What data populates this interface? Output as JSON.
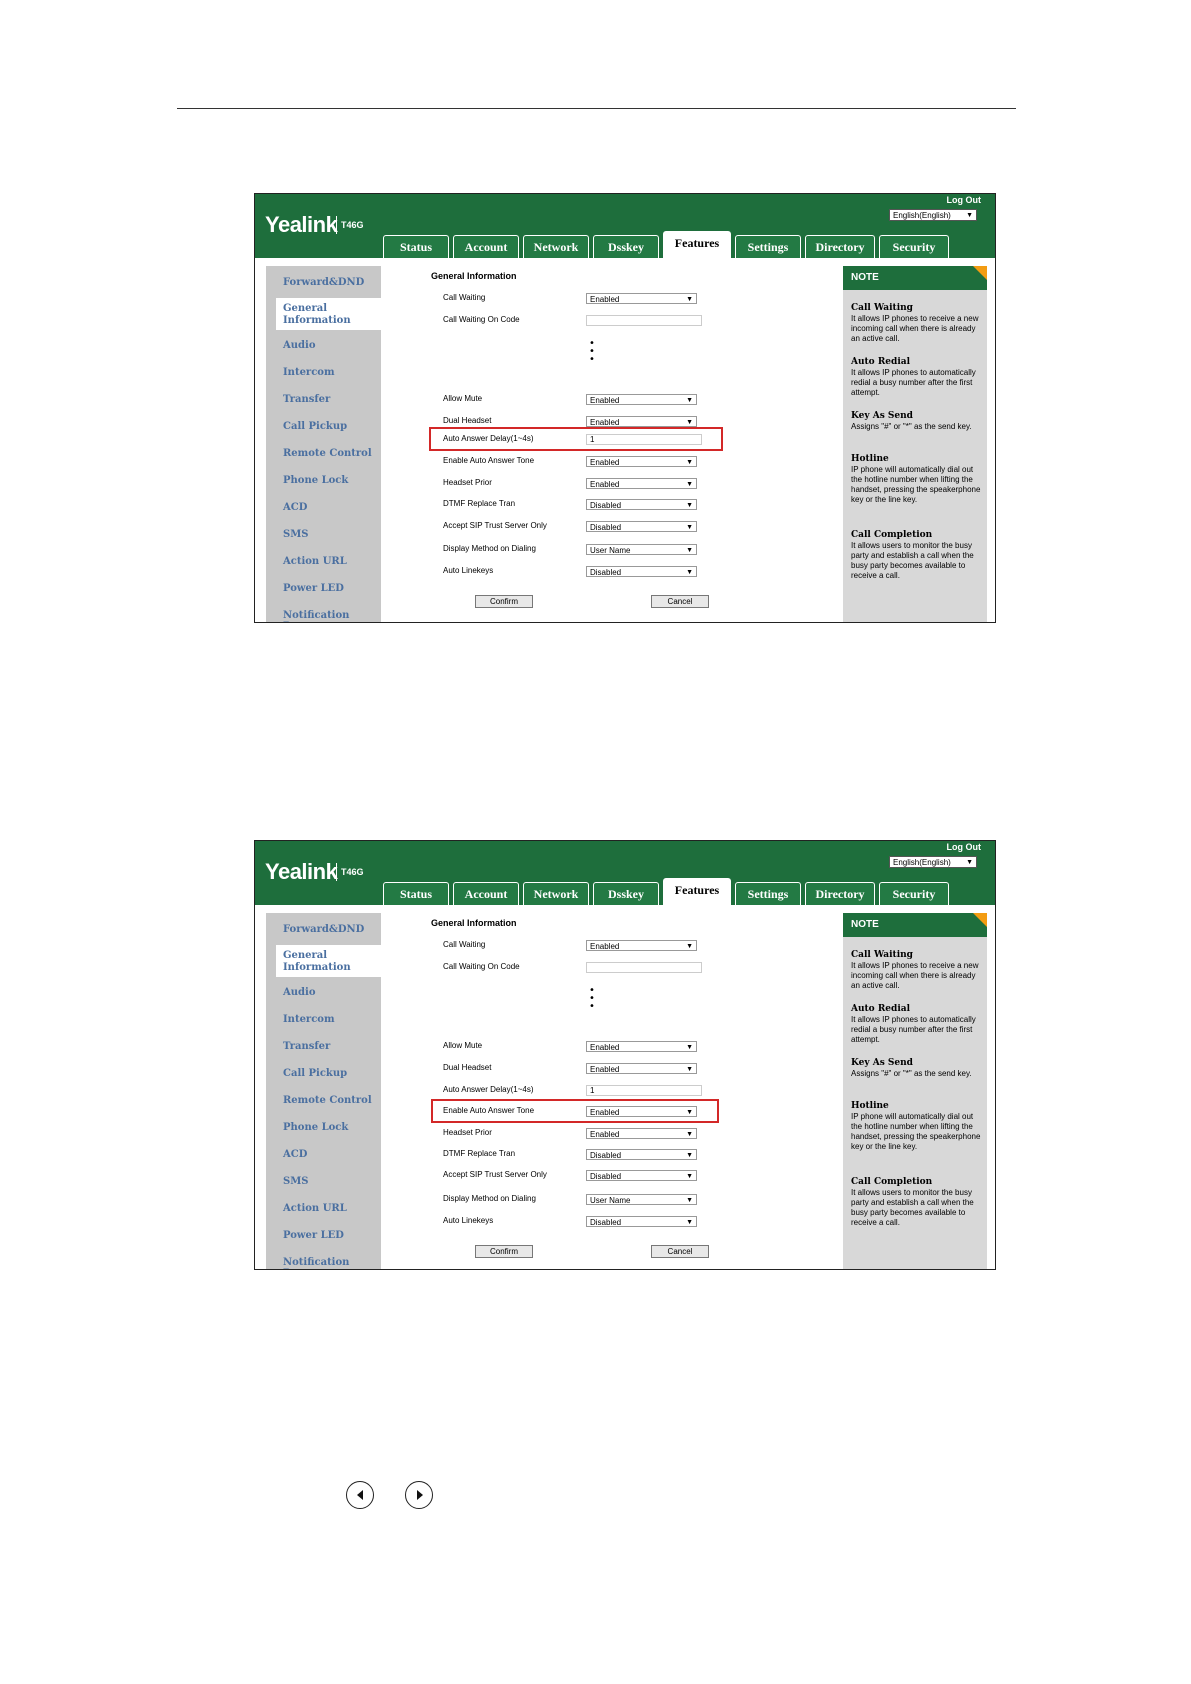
{
  "screens": [
    {
      "logout": "Log Out",
      "language": "English(English)",
      "brand": "Yealink",
      "model": "T46G",
      "tabs": [
        "Status",
        "Account",
        "Network",
        "Dsskey",
        "Features",
        "Settings",
        "Directory",
        "Security"
      ],
      "active_tab": "Features",
      "sidebar": [
        "Forward&DND",
        "General Information",
        "Audio",
        "Intercom",
        "Transfer",
        "Call Pickup",
        "Remote Control",
        "Phone Lock",
        "ACD",
        "SMS",
        "Action URL",
        "Power LED",
        "Notification Popups"
      ],
      "section_title": "General Information",
      "fields": {
        "call_waiting": {
          "label": "Call Waiting",
          "value": "Enabled"
        },
        "call_waiting_on_code": {
          "label": "Call Waiting On Code",
          "value": ""
        },
        "allow_mute": {
          "label": "Allow Mute",
          "value": "Enabled"
        },
        "dual_headset": {
          "label": "Dual Headset",
          "value": "Enabled"
        },
        "auto_answer_delay": {
          "label": "Auto Answer Delay(1~4s)",
          "value": "1"
        },
        "enable_auto_answer_tone": {
          "label": "Enable Auto Answer Tone",
          "value": "Enabled"
        },
        "headset_prior": {
          "label": "Headset Prior",
          "value": "Enabled"
        },
        "dtmf_replace_tran": {
          "label": "DTMF Replace Tran",
          "value": "Disabled"
        },
        "accept_sip_trust_server_only": {
          "label": "Accept SIP Trust Server Only",
          "value": "Disabled"
        },
        "display_method_on_dialing": {
          "label": "Display Method on Dialing",
          "value": "User Name"
        },
        "auto_linekeys": {
          "label": "Auto Linekeys",
          "value": "Disabled"
        }
      },
      "confirm": "Confirm",
      "cancel": "Cancel",
      "note": {
        "title": "NOTE",
        "items": [
          {
            "title": "Call Waiting",
            "text": "It allows IP phones to receive a new incoming call when there is already an active call."
          },
          {
            "title": "Auto Redial",
            "text": "It allows IP phones to automatically redial a busy number after the first attempt."
          },
          {
            "title": "Key As Send",
            "text": "Assigns \"#\" or \"*\" as the send key."
          },
          {
            "title": "Hotline",
            "text": "IP phone will automatically dial out the hotline number when lifting the handset, pressing the speakerphone key or the line key."
          },
          {
            "title": "Call Completion",
            "text": "It allows users to monitor the busy party and establish a call when the busy party becomes available to receive a call."
          }
        ]
      }
    },
    {
      "logout": "Log Out",
      "language": "English(English)",
      "brand": "Yealink",
      "model": "T46G",
      "tabs": [
        "Status",
        "Account",
        "Network",
        "Dsskey",
        "Features",
        "Settings",
        "Directory",
        "Security"
      ],
      "active_tab": "Features",
      "sidebar": [
        "Forward&DND",
        "General Information",
        "Audio",
        "Intercom",
        "Transfer",
        "Call Pickup",
        "Remote Control",
        "Phone Lock",
        "ACD",
        "SMS",
        "Action URL",
        "Power LED",
        "Notification Popups"
      ],
      "section_title": "General Information",
      "fields": {
        "call_waiting": {
          "label": "Call Waiting",
          "value": "Enabled"
        },
        "call_waiting_on_code": {
          "label": "Call Waiting On Code",
          "value": ""
        },
        "allow_mute": {
          "label": "Allow Mute",
          "value": "Enabled"
        },
        "dual_headset": {
          "label": "Dual Headset",
          "value": "Enabled"
        },
        "auto_answer_delay": {
          "label": "Auto Answer Delay(1~4s)",
          "value": "1"
        },
        "enable_auto_answer_tone": {
          "label": "Enable Auto Answer Tone",
          "value": "Enabled"
        },
        "headset_prior": {
          "label": "Headset Prior",
          "value": "Enabled"
        },
        "dtmf_replace_tran": {
          "label": "DTMF Replace Tran",
          "value": "Disabled"
        },
        "accept_sip_trust_server_only": {
          "label": "Accept SIP Trust Server Only",
          "value": "Disabled"
        },
        "display_method_on_dialing": {
          "label": "Display Method on Dialing",
          "value": "User Name"
        },
        "auto_linekeys": {
          "label": "Auto Linekeys",
          "value": "Disabled"
        }
      },
      "confirm": "Confirm",
      "cancel": "Cancel",
      "note": {
        "title": "NOTE",
        "items": [
          {
            "title": "Call Waiting",
            "text": "It allows IP phones to receive a new incoming call when there is already an active call."
          },
          {
            "title": "Auto Redial",
            "text": "It allows IP phones to automatically redial a busy number after the first attempt."
          },
          {
            "title": "Key As Send",
            "text": "Assigns \"#\" or \"*\" as the send key."
          },
          {
            "title": "Hotline",
            "text": "IP phone will automatically dial out the hotline number when lifting the handset, pressing the speakerphone key or the line key."
          },
          {
            "title": "Call Completion",
            "text": "It allows users to monitor the busy party and establish a call when the busy party becomes available to receive a call."
          }
        ]
      }
    }
  ],
  "colors": {
    "header_green": "#1e6e3c",
    "highlight_red": "#d32828",
    "note_accent": "#f39c12",
    "sidebar_link": "#4a6fa0"
  },
  "nav_icons": [
    "chevron-left-icon",
    "chevron-right-icon"
  ]
}
